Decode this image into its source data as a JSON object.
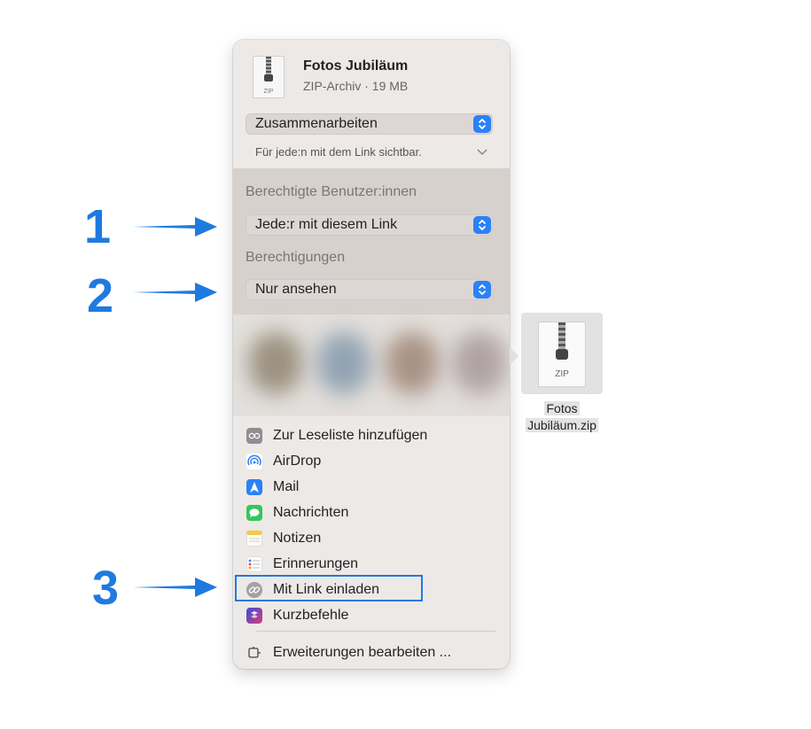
{
  "file": {
    "name": "Fotos Jubiläum",
    "meta": "ZIP-Archiv · 19 MB",
    "icon_label": "ZIP"
  },
  "share_mode": {
    "selected": "Zusammenarbeiten",
    "hint": "Für jede:n mit dem Link sichtbar."
  },
  "permissions": {
    "users_label": "Berechtigte Benutzer:innen",
    "users_selected": "Jede:r mit diesem Link",
    "rights_label": "Berechtigungen",
    "rights_selected": "Nur ansehen"
  },
  "menu": {
    "items": [
      {
        "label": "Zur Leseliste hinzufügen",
        "icon": "reading-list-icon"
      },
      {
        "label": "AirDrop",
        "icon": "airdrop-icon"
      },
      {
        "label": "Mail",
        "icon": "mail-icon"
      },
      {
        "label": "Nachrichten",
        "icon": "messages-icon"
      },
      {
        "label": "Notizen",
        "icon": "notes-icon"
      },
      {
        "label": "Erinnerungen",
        "icon": "reminders-icon"
      },
      {
        "label": "Mit Link einladen",
        "icon": "link-icon"
      },
      {
        "label": "Kurzbefehle",
        "icon": "shortcuts-icon"
      }
    ],
    "edit_extensions": "Erweiterungen bearbeiten ..."
  },
  "callouts": [
    "1",
    "2",
    "3"
  ],
  "thumbnail": {
    "icon_label": "ZIP",
    "line1": "Fotos",
    "line2": "Jubiläum.zip"
  },
  "colors": {
    "accent": "#1f7ae0",
    "panel": "#ede9e7",
    "stepper": "#2a82f6"
  }
}
